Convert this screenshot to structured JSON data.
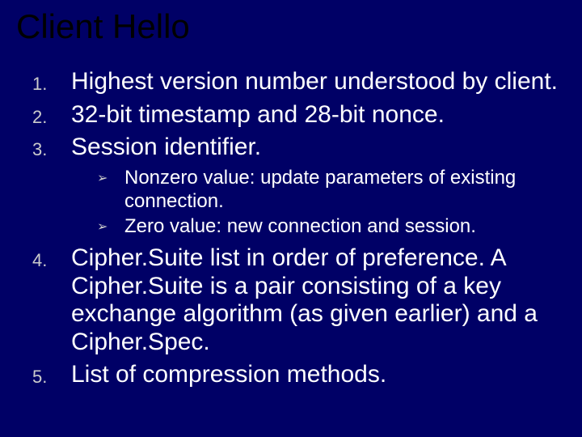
{
  "title": "Client Hello",
  "items": [
    {
      "num": "1.",
      "text": "Highest version number understood by client."
    },
    {
      "num": "2.",
      "text": "32-bit timestamp and 28-bit nonce."
    },
    {
      "num": "3.",
      "text": "Session identifier."
    }
  ],
  "subitems": [
    {
      "bullet": "➢",
      "text": "Nonzero value: update parameters of existing connection."
    },
    {
      "bullet": "➢",
      "text": "Zero value: new connection and session."
    }
  ],
  "items_after": [
    {
      "num": "4.",
      "text": "Cipher.Suite list in order of preference.  A Cipher.Suite is a pair consisting of a key exchange algorithm (as given earlier) and a Cipher.Spec."
    },
    {
      "num": "5.",
      "text": "List of compression methods."
    }
  ]
}
